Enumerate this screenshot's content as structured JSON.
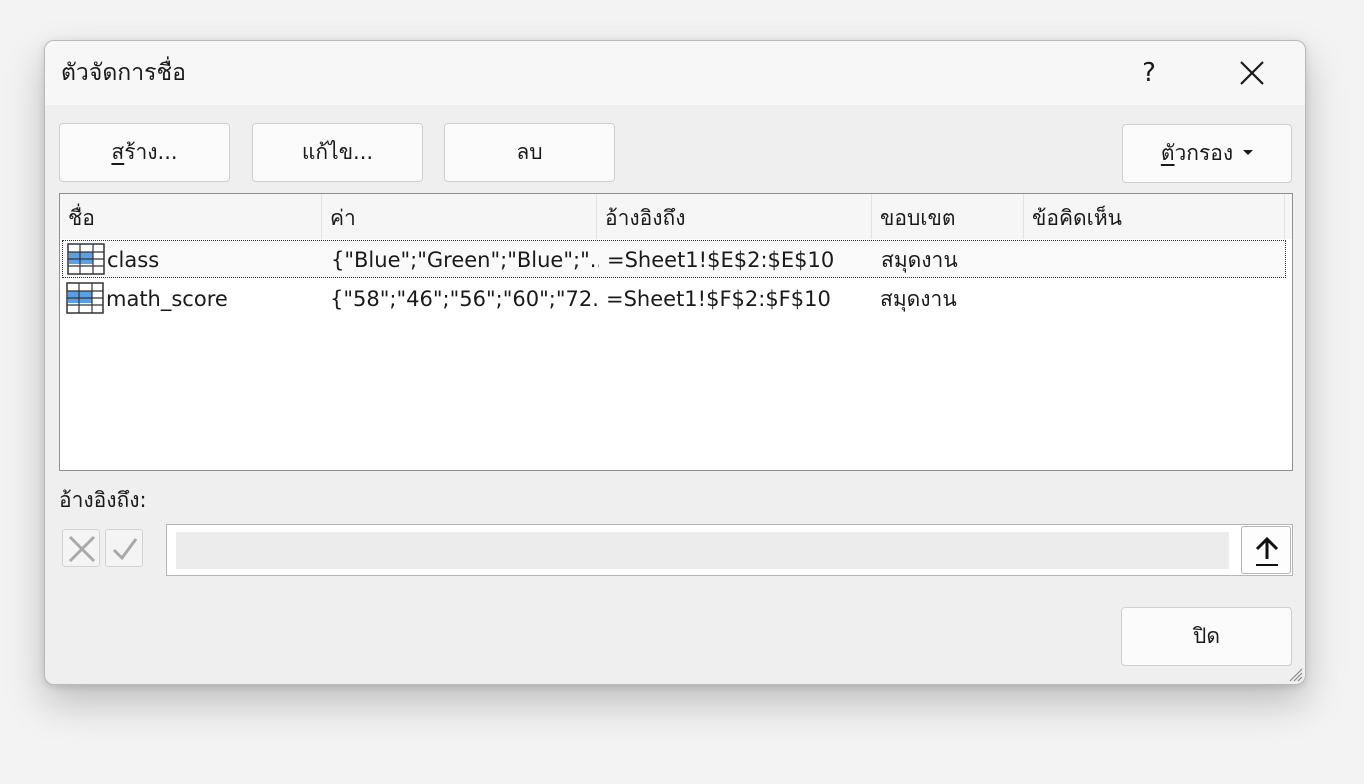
{
  "dialog": {
    "title": "ตัวจัดการชื่อ",
    "help_label": "?"
  },
  "toolbar": {
    "new_underlined": "ส",
    "new_rest": "ร้าง...",
    "edit_label": "แก้ไข...",
    "delete_label": "ลบ",
    "filter_underlined": "ตั",
    "filter_rest": "วกรอง"
  },
  "table": {
    "columns": [
      "ชื่อ",
      "ค่า",
      "อ้างอิงถึง",
      "ขอบเขต",
      "ข้อคิดเห็น"
    ],
    "rows": [
      {
        "name": "class",
        "value": "{\"Blue\";\"Green\";\"Blue\";\"...",
        "refers_to": "=Sheet1!$E$2:$E$10",
        "scope": "สมุดงาน",
        "comment": "",
        "selected": true
      },
      {
        "name": "math_score",
        "value": "{\"58\";\"46\";\"56\";\"60\";\"72...",
        "refers_to": "=Sheet1!$F$2:$F$10",
        "scope": "สมุดงาน",
        "comment": "",
        "selected": false
      }
    ]
  },
  "refers": {
    "label": "อ้างอิงถึง:",
    "value": ""
  },
  "footer": {
    "close_label": "ปิด"
  },
  "icons": {
    "row_icon": "named-range-table-icon",
    "cancel": "cancel-x-icon",
    "confirm": "checkmark-icon",
    "collapse": "collapse-arrow-icon",
    "close": "close-icon"
  },
  "colors": {
    "table_icon_fill": "#5aa0e6",
    "dialog_bg": "#efefef"
  }
}
